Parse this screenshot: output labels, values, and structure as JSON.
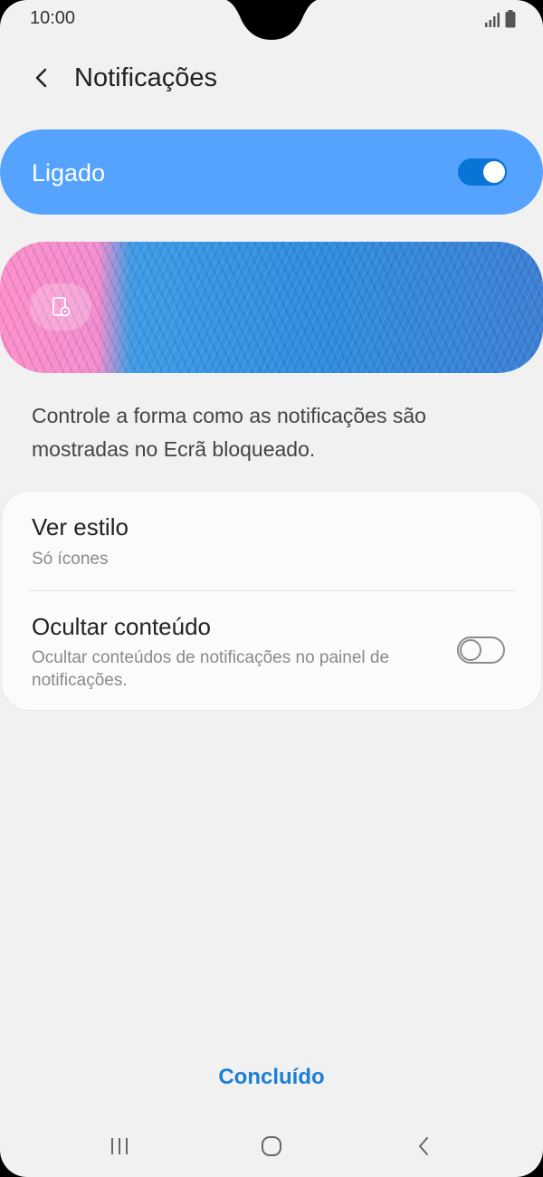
{
  "status_bar": {
    "time": "10:00",
    "icons": [
      "signal-icon",
      "battery-icon"
    ]
  },
  "header": {
    "back_icon": "chevron-left-icon",
    "title": "Notificações"
  },
  "master_toggle": {
    "label": "Ligado",
    "state": "on"
  },
  "preview": {
    "button_icon": "lock-screen-settings-icon"
  },
  "description": "Controle a forma como as notificações são mostradas no Ecrã bloqueado.",
  "settings": {
    "view_style": {
      "title": "Ver estilo",
      "value": "Só ícones"
    },
    "hide_content": {
      "title": "Ocultar conteúdo",
      "subtitle": "Ocultar conteúdos de notificações no painel de notificações.",
      "state": "off"
    }
  },
  "done_label": "Concluído",
  "navigation": {
    "recent_icon": "recent-apps-icon",
    "home_icon": "home-icon",
    "back_icon": "back-icon"
  },
  "colors": {
    "accent": "#55a3fe",
    "switch_on": "#0a74d6",
    "link": "#1a7fd6"
  }
}
